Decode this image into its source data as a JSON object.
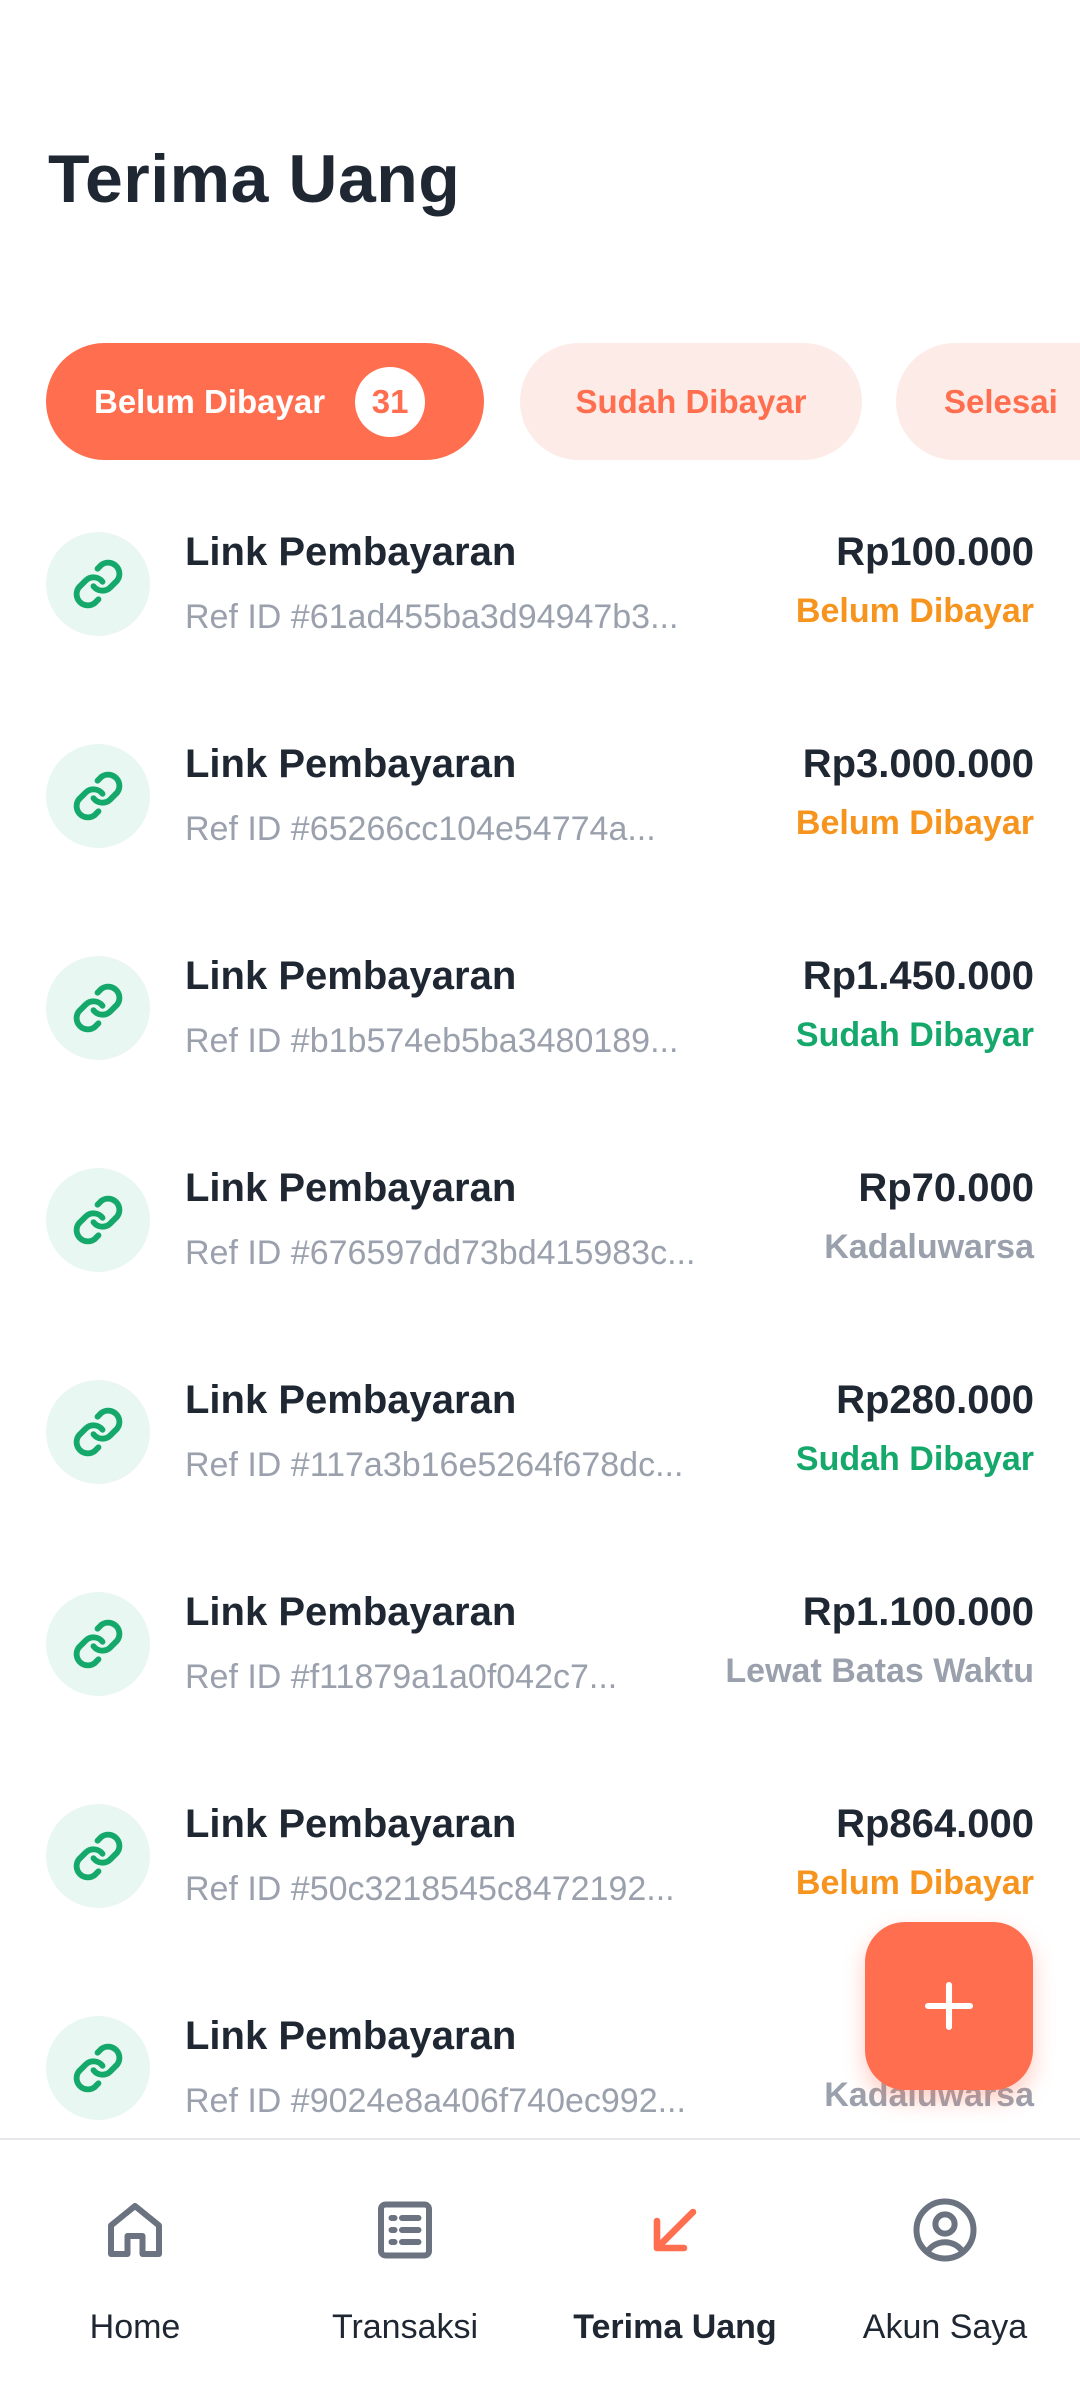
{
  "header": {
    "title": "Terima Uang"
  },
  "tabs": [
    {
      "label": "Belum Dibayar",
      "badge": "31",
      "active": true
    },
    {
      "label": "Sudah Dibayar",
      "active": false
    },
    {
      "label": "Selesai",
      "active": false
    }
  ],
  "items": [
    {
      "title": "Link Pembayaran",
      "ref": "Ref ID #61ad455ba3d94947b3...",
      "amount": "Rp100.000",
      "status": "Belum Dibayar",
      "status_color": "#f7941d"
    },
    {
      "title": "Link Pembayaran",
      "ref": "Ref ID #65266cc104e54774a...",
      "amount": "Rp3.000.000",
      "status": "Belum Dibayar",
      "status_color": "#f7941d"
    },
    {
      "title": "Link Pembayaran",
      "ref": "Ref ID #b1b574eb5ba3480189...",
      "amount": "Rp1.450.000",
      "status": "Sudah Dibayar",
      "status_color": "#14a86b"
    },
    {
      "title": "Link Pembayaran",
      "ref": "Ref ID #676597dd73bd415983c...",
      "amount": "Rp70.000",
      "status": "Kadaluwarsa",
      "status_color": "#9aa1ad"
    },
    {
      "title": "Link Pembayaran",
      "ref": "Ref ID #117a3b16e5264f678dc...",
      "amount": "Rp280.000",
      "status": "Sudah Dibayar",
      "status_color": "#14a86b"
    },
    {
      "title": "Link Pembayaran",
      "ref": "Ref ID #f11879a1a0f042c7...",
      "amount": "Rp1.100.000",
      "status": "Lewat Batas Waktu",
      "status_color": "#9aa1ad"
    },
    {
      "title": "Link Pembayaran",
      "ref": "Ref ID #50c3218545c8472192...",
      "amount": "Rp864.000",
      "status": "Belum Dibayar",
      "status_color": "#f7941d"
    },
    {
      "title": "Link Pembayaran",
      "ref": "Ref ID #9024e8a406f740ec992...",
      "amount": "",
      "status": "Kadaluwarsa",
      "status_color": "#9aa1ad"
    }
  ],
  "fab": {
    "icon": "plus-icon"
  },
  "nav": [
    {
      "label": "Home",
      "icon": "home-icon",
      "active": false
    },
    {
      "label": "Transaksi",
      "icon": "list-icon",
      "active": false
    },
    {
      "label": "Terima Uang",
      "icon": "arrow-down-left-icon",
      "active": true
    },
    {
      "label": "Akun Saya",
      "icon": "user-circle-icon",
      "active": false
    }
  ],
  "colors": {
    "accent": "#ff6e4f",
    "accent_light": "#fdebe7",
    "link_icon": "#14a86b",
    "link_icon_bg": "#e8f7f1"
  }
}
